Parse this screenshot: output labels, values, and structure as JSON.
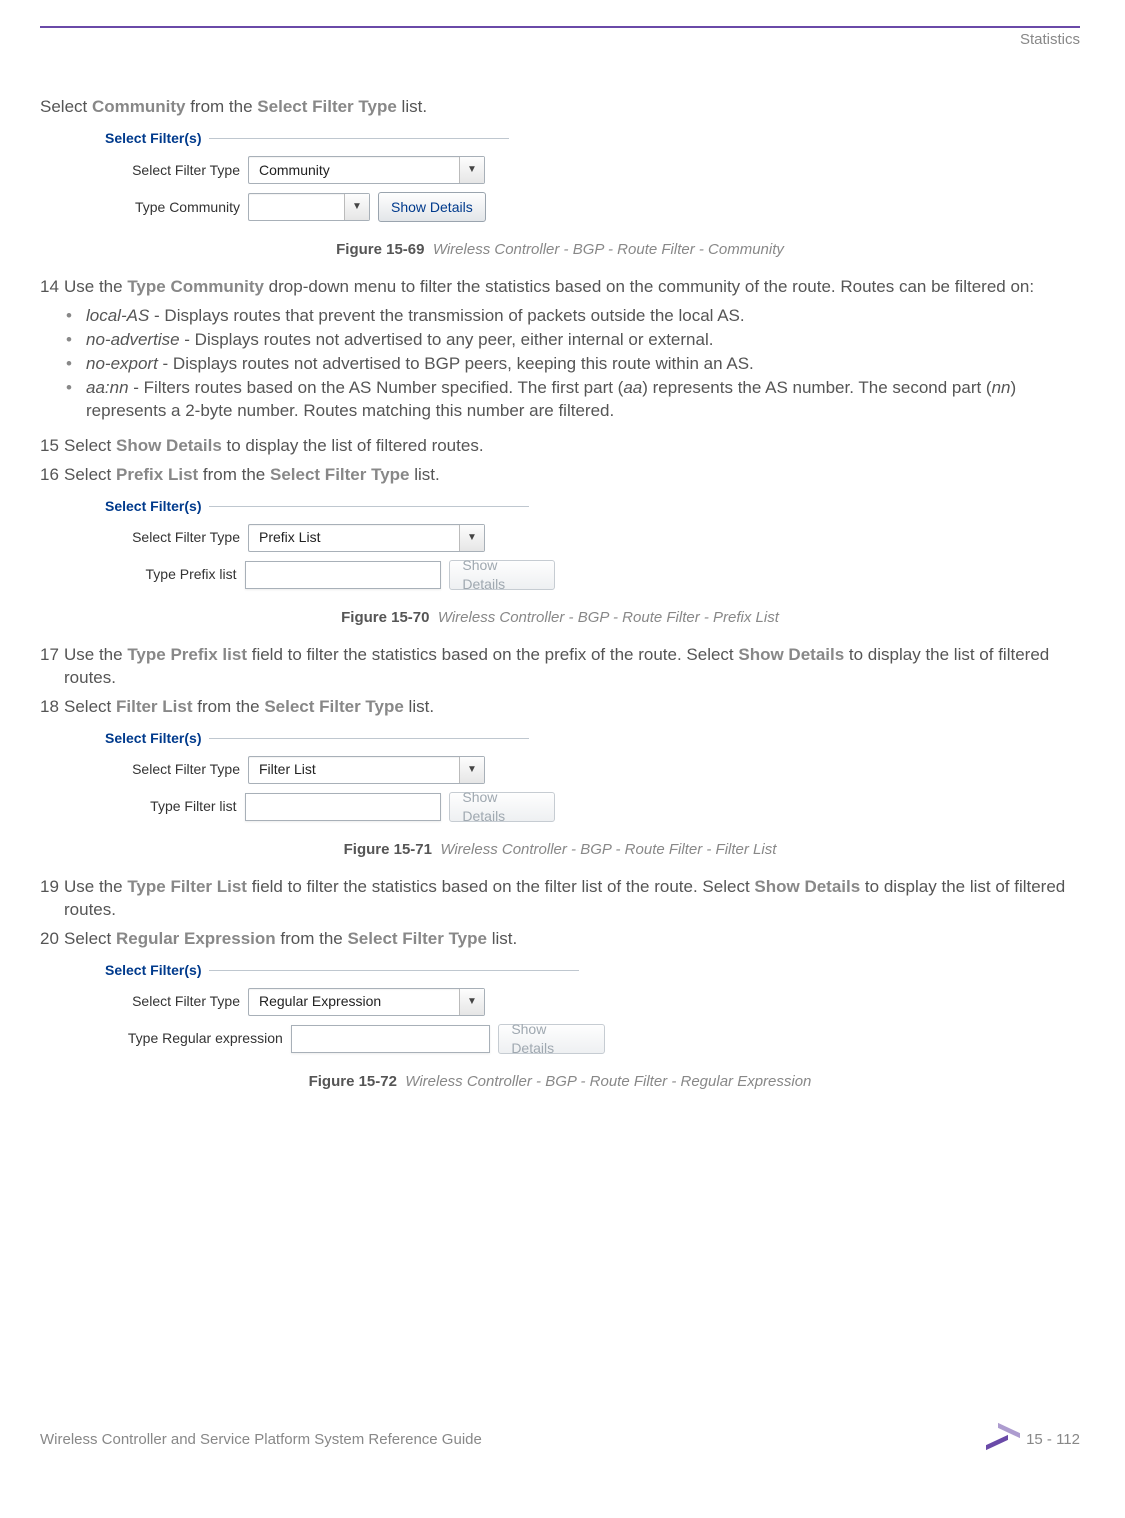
{
  "header": {
    "section": "Statistics"
  },
  "intro": {
    "pre": "Select ",
    "bold1": "Community",
    "mid": " from the ",
    "bold2": "Select Filter Type",
    "post": " list."
  },
  "fig69": {
    "title": "Select Filter(s)",
    "row1_label": "Select Filter Type",
    "row1_value": "Community",
    "row2_label": "Type Community",
    "button": "Show Details",
    "cap_num": "Figure 15-69",
    "cap_txt": "Wireless Controller - BGP - Route Filter - Community"
  },
  "step14": {
    "num": "14",
    "pre": "Use the ",
    "bold": "Type Community",
    "post": " drop-down menu to filter the statistics based on the community of the route. Routes can be filtered on:"
  },
  "bullets14": [
    {
      "term": "local-AS",
      "txt": " - Displays routes that prevent the transmission of packets outside the local AS."
    },
    {
      "term": "no-advertise",
      "txt": " - Displays routes not advertised to any peer, either internal or external."
    },
    {
      "term": "no-export",
      "txt": " - Displays routes not advertised to BGP peers, keeping this route within an AS."
    },
    {
      "term": "aa:nn",
      "txt1": " - Filters routes based on the AS Number specified. The first part (",
      "aa": "aa",
      "txt2": ") represents the AS number. The second part (",
      "nn": "nn",
      "txt3": ") represents a 2-byte number. Routes matching this number are filtered."
    }
  ],
  "step15": {
    "num": "15",
    "pre": "Select ",
    "bold": "Show Details",
    "post": " to display the list of filtered routes."
  },
  "step16": {
    "num": "16",
    "pre": "Select ",
    "bold": "Prefix List",
    "mid": " from the ",
    "bold2": "Select Filter Type",
    "post": " list."
  },
  "fig70": {
    "title": "Select Filter(s)",
    "row1_label": "Select Filter Type",
    "row1_value": "Prefix List",
    "row2_label": "Type Prefix list",
    "button": "Show Details",
    "cap_num": "Figure 15-70",
    "cap_txt": "Wireless Controller - BGP - Route Filter - Prefix List"
  },
  "step17": {
    "num": "17",
    "pre": "Use the ",
    "bold": "Type Prefix list",
    "mid": " field to filter the statistics based on the prefix of the route. Select ",
    "bold2": "Show Details",
    "post": " to display the list of filtered routes."
  },
  "step18": {
    "num": "18",
    "pre": "Select ",
    "bold": "Filter List",
    "mid": " from the ",
    "bold2": "Select Filter Type",
    "post": " list."
  },
  "fig71": {
    "title": "Select Filter(s)",
    "row1_label": "Select Filter Type",
    "row1_value": "Filter List",
    "row2_label": "Type Filter list",
    "button": "Show Details",
    "cap_num": "Figure 15-71",
    "cap_txt": "Wireless Controller - BGP - Route Filter - Filter List"
  },
  "step19": {
    "num": "19",
    "pre": "Use the ",
    "bold": "Type Filter List",
    "mid": " field to filter the statistics based on the filter list of the route. Select ",
    "bold2": "Show Details",
    "post": " to display the list of filtered routes."
  },
  "step20": {
    "num": "20",
    "pre": "Select ",
    "bold": "Regular Expression",
    "mid": " from the ",
    "bold2": "Select Filter Type",
    "post": " list."
  },
  "fig72": {
    "title": "Select Filter(s)",
    "row1_label": "Select Filter Type",
    "row1_value": "Regular Expression",
    "row2_label": "Type Regular expression",
    "button": "Show Details",
    "cap_num": "Figure 15-72",
    "cap_txt": "Wireless Controller - BGP - Route Filter - Regular Expression"
  },
  "footer": {
    "left": "Wireless Controller and Service Platform System Reference Guide",
    "right": "15 - 112"
  }
}
